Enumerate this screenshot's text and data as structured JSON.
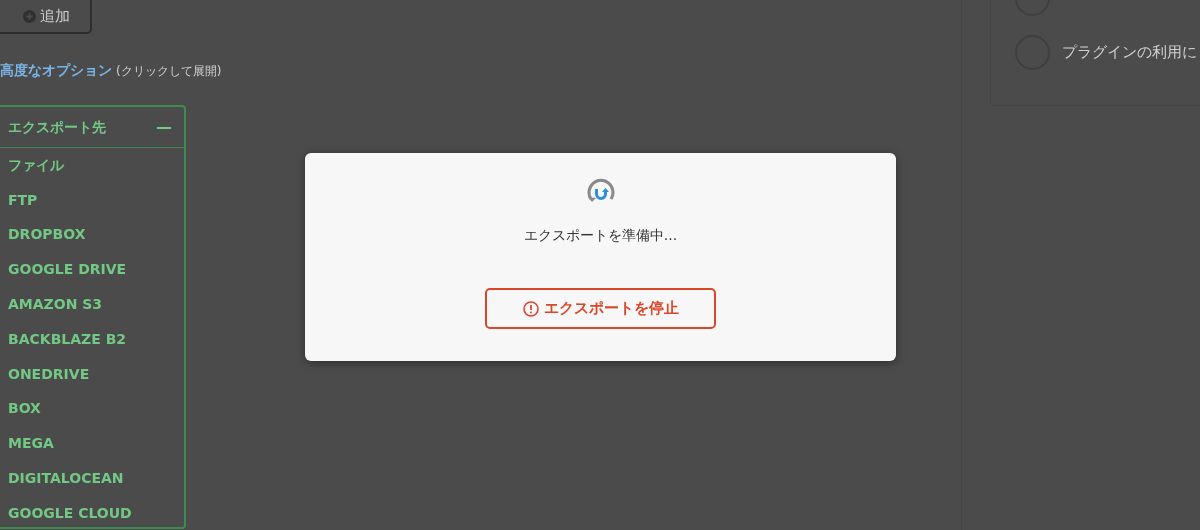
{
  "add_button": {
    "label": "追加"
  },
  "advanced_options": {
    "link": "高度なオプション",
    "hint": "(クリックして展開)"
  },
  "export_panel": {
    "title": "エクスポート先",
    "toggle": "—",
    "expanded": true,
    "items": [
      "ファイル",
      "FTP",
      "DROPBOX",
      "GOOGLE DRIVE",
      "AMAZON S3",
      "BACKBLAZE B2",
      "ONEDRIVE",
      "BOX",
      "MEGA",
      "DIGITALOCEAN",
      "GOOGLE CLOUD"
    ]
  },
  "right_panel": {
    "options": [
      {
        "selected": false
      },
      {
        "label": "プラグインの利用に",
        "selected": false
      }
    ]
  },
  "modal": {
    "message": "エクスポートを準備中...",
    "stop_button": "エクスポートを停止"
  }
}
